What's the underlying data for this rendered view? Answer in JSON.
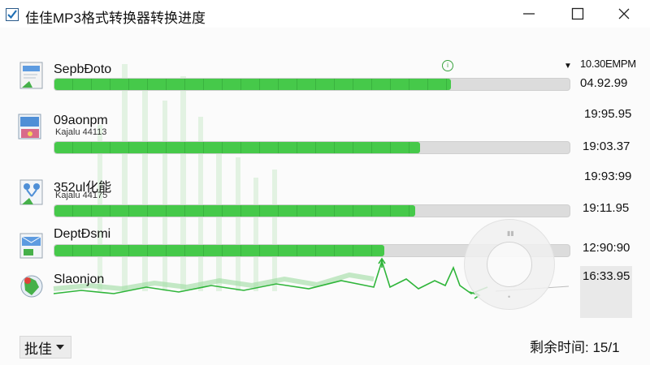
{
  "window": {
    "title": "佳佳MP3格式转换器转换进度",
    "controls": {
      "minimize_icon": "minimize-icon",
      "maximize_icon": "maximize-icon",
      "close_icon": "close-icon"
    }
  },
  "list_header": {
    "time": "10.30EMPM",
    "sort_icon": "sort-down-icon",
    "status_icon": "circle-status-icon"
  },
  "items": [
    {
      "name": "SepbĐoto",
      "subtitle": "",
      "progress": 0.77,
      "time": "04.92.99",
      "icon": "document-file-icon"
    },
    {
      "name": "09aonpm",
      "subtitle": "Kajalu 44113",
      "progress": 0.71,
      "time": "19:03.37",
      "time_above": "19:95.95",
      "icon": "media-file-icon"
    },
    {
      "name": "352ul化能",
      "subtitle": "Kajalu 44175",
      "progress": 0.7,
      "time": "19:11.95",
      "time_above": "19:93:99",
      "icon": "network-file-icon"
    },
    {
      "name": "DeptĐsmi",
      "subtitle": "",
      "progress": 0.64,
      "time": "12:90:90",
      "icon": "mail-file-icon"
    },
    {
      "name": "Slaonjon",
      "subtitle": "",
      "progress": null,
      "time": "16:33.95",
      "icon": "maps-file-icon"
    }
  ],
  "footer": {
    "batch_label": "批佳",
    "remaining_label": "剩余时间: 15/1"
  },
  "colors": {
    "accent": "#46c94a",
    "track": "#dcdcdc",
    "wave": "#2fb53a"
  }
}
